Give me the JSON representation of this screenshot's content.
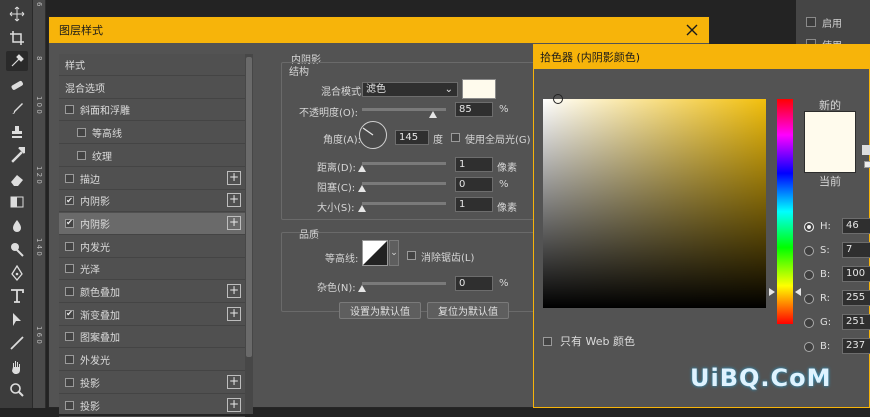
{
  "toolbar": {
    "tools": [
      "move-icon",
      "crop-icon",
      "eyedropper-icon",
      "healing-icon",
      "brush-icon",
      "stamp-icon",
      "history-brush-icon",
      "eraser-icon",
      "gradient-icon",
      "blur-icon",
      "dodge-icon",
      "pen-icon",
      "type-icon",
      "path-select-icon",
      "line-icon",
      "hand-icon",
      "zoom-icon"
    ]
  },
  "ruler": {
    "marks": [
      "6",
      "8",
      "1 0 0",
      "1 2 0",
      "1 4 0",
      "1 6 0"
    ]
  },
  "right_panel": {
    "items": [
      "启用",
      "使用"
    ]
  },
  "layer_style": {
    "title": "图层样式",
    "list": [
      {
        "label": "样式",
        "checkbox": false,
        "plus": false,
        "checked": false,
        "indent": 0
      },
      {
        "label": "混合选项",
        "checkbox": false,
        "plus": false,
        "checked": false,
        "indent": 0
      },
      {
        "label": "斜面和浮雕",
        "checkbox": true,
        "plus": false,
        "checked": false,
        "indent": 0
      },
      {
        "label": "等高线",
        "checkbox": true,
        "plus": false,
        "checked": false,
        "indent": 1
      },
      {
        "label": "纹理",
        "checkbox": true,
        "plus": false,
        "checked": false,
        "indent": 1
      },
      {
        "label": "描边",
        "checkbox": true,
        "plus": true,
        "checked": false,
        "indent": 0
      },
      {
        "label": "内阴影",
        "checkbox": true,
        "plus": true,
        "checked": true,
        "indent": 0
      },
      {
        "label": "内阴影",
        "checkbox": true,
        "plus": true,
        "checked": true,
        "indent": 0,
        "selected": true
      },
      {
        "label": "内发光",
        "checkbox": true,
        "plus": false,
        "checked": false,
        "indent": 0
      },
      {
        "label": "光泽",
        "checkbox": true,
        "plus": false,
        "checked": false,
        "indent": 0
      },
      {
        "label": "颜色叠加",
        "checkbox": true,
        "plus": true,
        "checked": false,
        "indent": 0
      },
      {
        "label": "渐变叠加",
        "checkbox": true,
        "plus": true,
        "checked": true,
        "indent": 0
      },
      {
        "label": "图案叠加",
        "checkbox": true,
        "plus": false,
        "checked": false,
        "indent": 0
      },
      {
        "label": "外发光",
        "checkbox": true,
        "plus": false,
        "checked": false,
        "indent": 0
      },
      {
        "label": "投影",
        "checkbox": true,
        "plus": true,
        "checked": false,
        "indent": 0
      },
      {
        "label": "投影",
        "checkbox": true,
        "plus": true,
        "checked": false,
        "indent": 0
      }
    ],
    "section_title": "内阴影",
    "structure_title": "结构",
    "blend_mode_label": "混合模式:",
    "blend_mode_value": "滤色",
    "shadow_color": "#fffbed",
    "opacity_label": "不透明度(O):",
    "opacity_value": "85",
    "opacity_percent": 85,
    "percent_unit": "%",
    "angle_label": "角度(A):",
    "angle_value": "145",
    "degree_unit": "度",
    "global_light_label": "使用全局光(G)",
    "distance_label": "距离(D):",
    "distance_value": "1",
    "pixel_unit": "像素",
    "choke_label": "阻塞(C):",
    "choke_value": "0",
    "size_label": "大小(S):",
    "size_value": "1",
    "quality_title": "品质",
    "contour_label": "等高线:",
    "antialias_label": "消除锯齿(L)",
    "noise_label": "杂色(N):",
    "noise_value": "0",
    "set_default_button": "设置为默认值",
    "reset_default_button": "复位为默认值"
  },
  "color_picker": {
    "title": "拾色器 (内阴影颜色)",
    "new_label": "新的",
    "current_label": "当前",
    "new_color": "#fffbed",
    "web_only_label": "只有 Web 颜色",
    "fields": [
      {
        "label": "H:",
        "value": "46",
        "checked": true
      },
      {
        "label": "S:",
        "value": "7",
        "checked": false
      },
      {
        "label": "B:",
        "value": "100",
        "checked": false
      },
      {
        "label": "R:",
        "value": "255",
        "checked": false
      },
      {
        "label": "G:",
        "value": "251",
        "checked": false
      },
      {
        "label": "B:",
        "value": "237",
        "checked": false
      }
    ]
  },
  "watermark": "UiBQ.CoM",
  "colors": {
    "accent": "#f7b40a"
  }
}
